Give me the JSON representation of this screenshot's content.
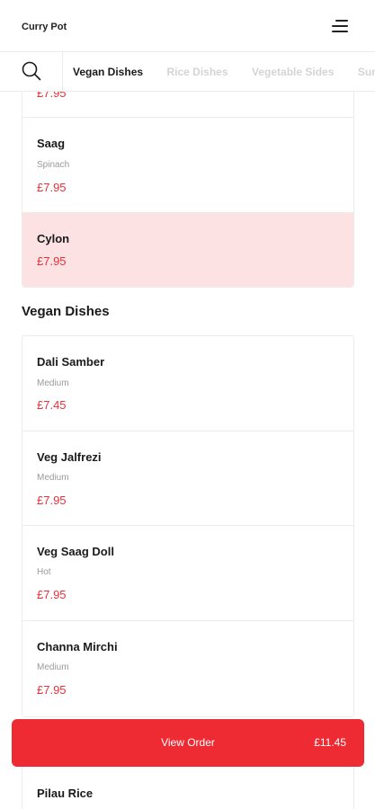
{
  "header": {
    "title": "Curry Pot",
    "menu_icon": "hamburger-menu-icon"
  },
  "tabbar": {
    "search_icon": "search-icon",
    "tabs": [
      {
        "label": "Vegan Dishes",
        "active": true
      },
      {
        "label": "Rice Dishes",
        "active": false
      },
      {
        "label": "Vegetable Sides",
        "active": false
      },
      {
        "label": "Sundries",
        "active": false
      }
    ]
  },
  "previous_section": {
    "items": [
      {
        "name": "",
        "desc": "",
        "price": "£7.95"
      },
      {
        "name": "Saag",
        "desc": "Spinach",
        "price": "£7.95"
      },
      {
        "name": "Cylon",
        "desc": "",
        "price": "£7.95"
      }
    ]
  },
  "vegan_section": {
    "title": "Vegan Dishes",
    "items": [
      {
        "name": "Dali Samber",
        "desc": "Medium",
        "price": "£7.45"
      },
      {
        "name": "Veg Jalfrezi",
        "desc": "Medium",
        "price": "£7.95"
      },
      {
        "name": "Veg Saag Doll",
        "desc": "Hot",
        "price": "£7.95"
      },
      {
        "name": "Channa Mirchi",
        "desc": "Medium",
        "price": "£7.95"
      }
    ]
  },
  "rice_section": {
    "items": [
      {
        "name": "Pilau Rice"
      }
    ]
  },
  "order_bar": {
    "label": "View Order",
    "total": "£11.45"
  },
  "colors": {
    "accent": "#ee2a33",
    "price": "#e8303a",
    "highlight": "#fde2e3"
  }
}
